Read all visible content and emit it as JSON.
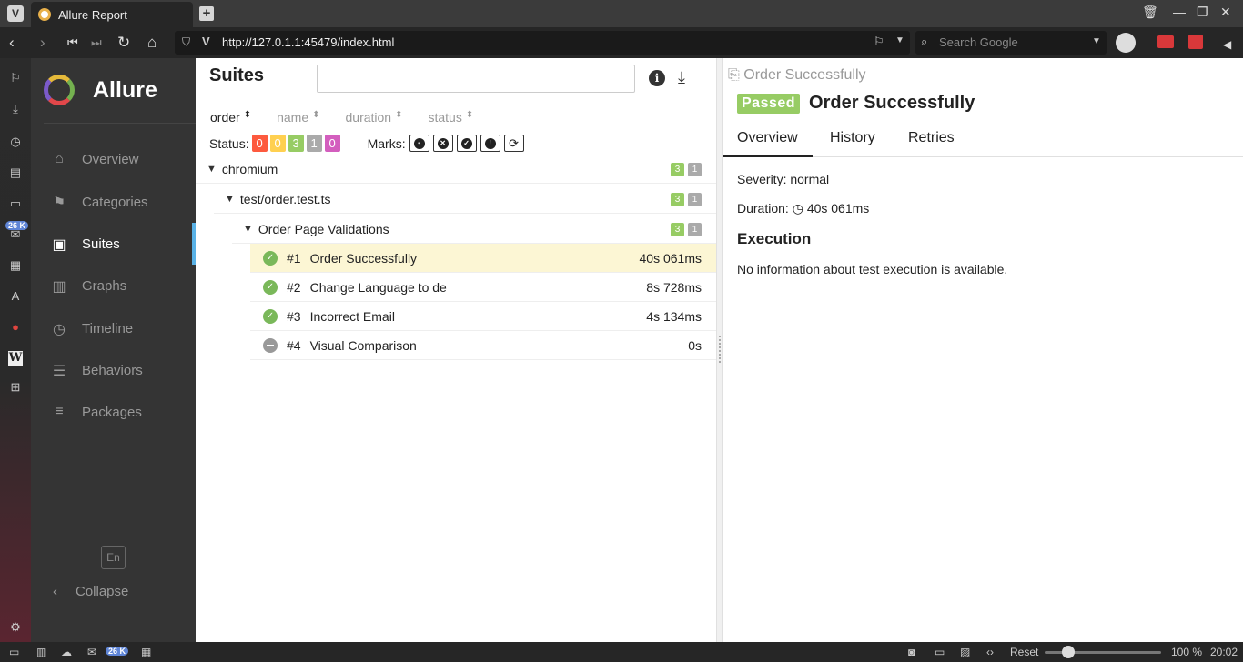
{
  "browser": {
    "tab_title": "Allure Report",
    "url": "http://127.0.1.1:45479/index.html",
    "search_placeholder": "Search Google",
    "panel_badge": "26 K"
  },
  "sidebar": {
    "brand": "Allure",
    "items": [
      {
        "label": "Overview",
        "icon": "home-icon"
      },
      {
        "label": "Categories",
        "icon": "flag-icon"
      },
      {
        "label": "Suites",
        "icon": "briefcase-icon"
      },
      {
        "label": "Graphs",
        "icon": "bar-chart-icon"
      },
      {
        "label": "Timeline",
        "icon": "clock-icon"
      },
      {
        "label": "Behaviors",
        "icon": "list-icon"
      },
      {
        "label": "Packages",
        "icon": "align-left-icon"
      }
    ],
    "lang": "En",
    "collapse": "Collapse"
  },
  "suites": {
    "title": "Suites",
    "sort": [
      "order",
      "name",
      "duration",
      "status"
    ],
    "status_label": "Status:",
    "status_counts": [
      {
        "value": "0",
        "color": "#fd5a3e"
      },
      {
        "value": "0",
        "color": "#ffd050"
      },
      {
        "value": "3",
        "color": "#97cc64"
      },
      {
        "value": "1",
        "color": "#aaaaaa"
      },
      {
        "value": "0",
        "color": "#d35ebe"
      }
    ],
    "marks_label": "Marks:",
    "tree": {
      "root": {
        "name": "chromium",
        "passed": "3",
        "skipped": "1"
      },
      "file": {
        "name": "test/order.test.ts",
        "passed": "3",
        "skipped": "1"
      },
      "suite": {
        "name": "Order Page Validations",
        "passed": "3",
        "skipped": "1"
      }
    },
    "tests": [
      {
        "num": "#1",
        "name": "Order Successfully",
        "duration": "40s 061ms",
        "status": "passed"
      },
      {
        "num": "#2",
        "name": "Change Language to de",
        "duration": "8s 728ms",
        "status": "passed"
      },
      {
        "num": "#3",
        "name": "Incorrect Email",
        "duration": "4s 134ms",
        "status": "passed"
      },
      {
        "num": "#4",
        "name": "Visual Comparison",
        "duration": "0s",
        "status": "skipped"
      }
    ]
  },
  "detail": {
    "breadcrumb": "Order Successfully",
    "status": "Passed",
    "title": "Order Successfully",
    "tabs": [
      "Overview",
      "History",
      "Retries"
    ],
    "severity": "Severity: normal",
    "duration_label": "Duration:",
    "duration": "40s 061ms",
    "execution_title": "Execution",
    "execution_text": "No information about test execution is available."
  },
  "statusbar": {
    "badge": "26 K",
    "reset": "Reset",
    "zoom": "100 %",
    "time": "20:02"
  }
}
